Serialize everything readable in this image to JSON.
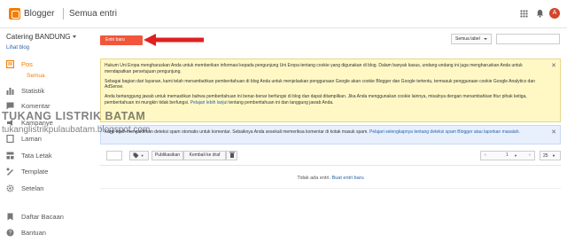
{
  "header": {
    "brand": "Blogger",
    "breadcrumb": "Semua entri",
    "avatar_letter": "A"
  },
  "sidebar": {
    "blog_name": "Catering BANDUNG",
    "view_blog": "Lihat blog",
    "items": [
      {
        "label": "Pos",
        "icon": "posts-icon"
      },
      {
        "label": "Statistik",
        "icon": "stats-icon"
      },
      {
        "label": "Komentar",
        "icon": "comments-icon"
      },
      {
        "label": "Kampanye",
        "icon": "campaign-icon"
      },
      {
        "label": "Laman",
        "icon": "pages-icon"
      },
      {
        "label": "Tata Letak",
        "icon": "layout-icon"
      },
      {
        "label": "Template",
        "icon": "template-icon"
      },
      {
        "label": "Setelan",
        "icon": "settings-icon"
      },
      {
        "label": "Daftar Bacaan",
        "icon": "reading-list-icon"
      },
      {
        "label": "Bantuan",
        "icon": "help-icon"
      }
    ],
    "sub_item": "Semua"
  },
  "toolbar": {
    "new_post": "Entri baru",
    "label_select": "Semua label",
    "search_placeholder": ""
  },
  "notice_cookie": {
    "p1": "Hukum Uni Eropa mengharuskan Anda untuk memberikan informasi kepada pengunjung Uni Eropa tentang cookie yang digunakan di blog. Dalam banyak kasus, undang-undang ini juga mengharuskan Anda untuk mendapatkan persetujuan pengunjung.",
    "p2": "Sebagai bagian dari layanan, kami telah menambahkan pemberitahuan di blog Anda untuk menjelaskan penggunaan Google akan cookie Blogger dan Google tertentu, termasuk penggunaan cookie Google Analytics dan AdSense.",
    "p3": "Anda bertanggung jawab untuk memastikan bahwa pemberitahuan ini benar-benar berfungsi di blog dan dapat ditampilkan. Jika Anda menggunakan cookie lainnya, misalnya dengan menambahkan fitur pihak ketiga, pemberitahuan ini mungkin tidak berfungsi.",
    "p3_link": "Pelajari lebih lanjut",
    "p3_tail": "tentang pemberitahuan ini dan tanggung jawab Anda."
  },
  "notice_spam": {
    "text": "Kami telah mengaktifkan deteksi spam otomatis untuk komentar. Sebaiknya Anda sesekali memeriksa komentar di kotak masuk spam.",
    "link": "Pelajari selengkapnya tentang deteksi spam Blogger atau laporkan masalah."
  },
  "watermark": {
    "line1": "TUKANG LISTRIK BATAM",
    "line2": "tukanglistrikpulaubatam.blogspot.com"
  },
  "actions": {
    "publish": "Publikasikan",
    "revert": "Kembali ke draf",
    "page_num": "1",
    "per_page": "25"
  },
  "empty_state": {
    "text": "Tidak ada entri.",
    "link": "Buat entri baru"
  },
  "colors": {
    "accent": "#f57d00",
    "new_post_button": "#f1563a",
    "arrow": "#e02020",
    "notice_yellow": "#fff8c5",
    "notice_blue": "#e8f0fe",
    "link": "#2962a7"
  }
}
